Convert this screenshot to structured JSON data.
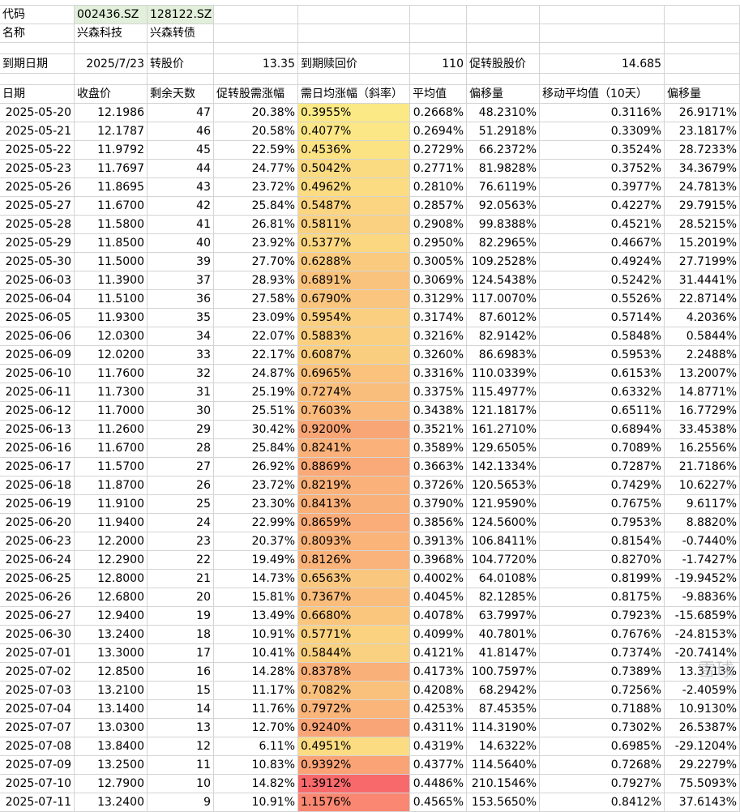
{
  "info": {
    "code_label": "代码",
    "code_stock": "002436.SZ",
    "code_bond": "128122.SZ",
    "name_label": "名称",
    "name_stock": "兴森科技",
    "name_bond": "兴森转债",
    "expiry_label": "到期日期",
    "expiry_value": "2025/7/23",
    "conv_label": "转股价",
    "conv_value": "13.35",
    "redeem_label": "到期赎回价",
    "redeem_value": "110",
    "promote_label": "促转股股价",
    "promote_value": "14.685"
  },
  "headers": [
    "日期",
    "收盘价",
    "剩余天数",
    "促转股需涨幅",
    "需日均涨幅（斜率）",
    "平均值",
    "偏移量",
    "移动平均值（10天）",
    "偏移量"
  ],
  "rows": [
    [
      "2025-05-20",
      "12.1986",
      "47",
      "20.38%",
      "0.3955%",
      "0.2668%",
      "48.2310%",
      "0.3116%",
      "26.9171%"
    ],
    [
      "2025-05-21",
      "12.1787",
      "46",
      "20.58%",
      "0.4077%",
      "0.2694%",
      "51.2918%",
      "0.3309%",
      "23.1817%"
    ],
    [
      "2025-05-22",
      "11.9792",
      "45",
      "22.59%",
      "0.4536%",
      "0.2729%",
      "66.2372%",
      "0.3524%",
      "28.7233%"
    ],
    [
      "2025-05-23",
      "11.7697",
      "44",
      "24.77%",
      "0.5042%",
      "0.2771%",
      "81.9828%",
      "0.3752%",
      "34.3679%"
    ],
    [
      "2025-05-26",
      "11.8695",
      "43",
      "23.72%",
      "0.4962%",
      "0.2810%",
      "76.6119%",
      "0.3977%",
      "24.7813%"
    ],
    [
      "2025-05-27",
      "11.6700",
      "42",
      "25.84%",
      "0.5487%",
      "0.2857%",
      "92.0563%",
      "0.4227%",
      "29.7915%"
    ],
    [
      "2025-05-28",
      "11.5800",
      "41",
      "26.81%",
      "0.5811%",
      "0.2908%",
      "99.8388%",
      "0.4521%",
      "28.5215%"
    ],
    [
      "2025-05-29",
      "11.8500",
      "40",
      "23.92%",
      "0.5377%",
      "0.2950%",
      "82.2965%",
      "0.4667%",
      "15.2019%"
    ],
    [
      "2025-05-30",
      "11.5000",
      "39",
      "27.70%",
      "0.6288%",
      "0.3005%",
      "109.2528%",
      "0.4924%",
      "27.7199%"
    ],
    [
      "2025-06-03",
      "11.3900",
      "37",
      "28.93%",
      "0.6891%",
      "0.3069%",
      "124.5438%",
      "0.5242%",
      "31.4441%"
    ],
    [
      "2025-06-04",
      "11.5100",
      "36",
      "27.58%",
      "0.6790%",
      "0.3129%",
      "117.0070%",
      "0.5526%",
      "22.8714%"
    ],
    [
      "2025-06-05",
      "11.9300",
      "35",
      "23.09%",
      "0.5954%",
      "0.3174%",
      "87.6012%",
      "0.5714%",
      "4.2036%"
    ],
    [
      "2025-06-06",
      "12.0300",
      "34",
      "22.07%",
      "0.5883%",
      "0.3216%",
      "82.9142%",
      "0.5848%",
      "0.5844%"
    ],
    [
      "2025-06-09",
      "12.0200",
      "33",
      "22.17%",
      "0.6087%",
      "0.3260%",
      "86.6983%",
      "0.5953%",
      "2.2488%"
    ],
    [
      "2025-06-10",
      "11.7600",
      "32",
      "24.87%",
      "0.6965%",
      "0.3316%",
      "110.0339%",
      "0.6153%",
      "13.2007%"
    ],
    [
      "2025-06-11",
      "11.7300",
      "31",
      "25.19%",
      "0.7274%",
      "0.3375%",
      "115.4977%",
      "0.6332%",
      "14.8771%"
    ],
    [
      "2025-06-12",
      "11.7000",
      "30",
      "25.51%",
      "0.7603%",
      "0.3438%",
      "121.1817%",
      "0.6511%",
      "16.7729%"
    ],
    [
      "2025-06-13",
      "11.2600",
      "29",
      "30.42%",
      "0.9200%",
      "0.3521%",
      "161.2710%",
      "0.6894%",
      "33.4538%"
    ],
    [
      "2025-06-16",
      "11.6700",
      "28",
      "25.84%",
      "0.8241%",
      "0.3589%",
      "129.6505%",
      "0.7089%",
      "16.2556%"
    ],
    [
      "2025-06-17",
      "11.5700",
      "27",
      "26.92%",
      "0.8869%",
      "0.3663%",
      "142.1334%",
      "0.7287%",
      "21.7186%"
    ],
    [
      "2025-06-18",
      "11.8700",
      "26",
      "23.72%",
      "0.8219%",
      "0.3726%",
      "120.5653%",
      "0.7429%",
      "10.6227%"
    ],
    [
      "2025-06-19",
      "11.9100",
      "25",
      "23.30%",
      "0.8413%",
      "0.3790%",
      "121.9590%",
      "0.7675%",
      "9.6117%"
    ],
    [
      "2025-06-20",
      "11.9400",
      "24",
      "22.99%",
      "0.8659%",
      "0.3856%",
      "124.5600%",
      "0.7953%",
      "8.8820%"
    ],
    [
      "2025-06-23",
      "12.2000",
      "23",
      "20.37%",
      "0.8093%",
      "0.3913%",
      "106.8411%",
      "0.8154%",
      "-0.7440%"
    ],
    [
      "2025-06-24",
      "12.2900",
      "22",
      "19.49%",
      "0.8126%",
      "0.3968%",
      "104.7720%",
      "0.8270%",
      "-1.7427%"
    ],
    [
      "2025-06-25",
      "12.8000",
      "21",
      "14.73%",
      "0.6563%",
      "0.4002%",
      "64.0108%",
      "0.8199%",
      "-19.9452%"
    ],
    [
      "2025-06-26",
      "12.6800",
      "20",
      "15.81%",
      "0.7367%",
      "0.4045%",
      "82.1285%",
      "0.8175%",
      "-9.8836%"
    ],
    [
      "2025-06-27",
      "12.9400",
      "19",
      "13.49%",
      "0.6680%",
      "0.4078%",
      "63.7997%",
      "0.7923%",
      "-15.6859%"
    ],
    [
      "2025-06-30",
      "13.2400",
      "18",
      "10.91%",
      "0.5771%",
      "0.4099%",
      "40.7801%",
      "0.7676%",
      "-24.8153%"
    ],
    [
      "2025-07-01",
      "13.3000",
      "17",
      "10.41%",
      "0.5844%",
      "0.4121%",
      "41.8147%",
      "0.7374%",
      "-20.7414%"
    ],
    [
      "2025-07-02",
      "12.8500",
      "16",
      "14.28%",
      "0.8378%",
      "0.4173%",
      "100.7597%",
      "0.7389%",
      "13.3713%"
    ],
    [
      "2025-07-03",
      "13.2100",
      "15",
      "11.17%",
      "0.7082%",
      "0.4208%",
      "68.2942%",
      "0.7256%",
      "-2.4059%"
    ],
    [
      "2025-07-04",
      "13.1400",
      "14",
      "11.76%",
      "0.7972%",
      "0.4253%",
      "87.4535%",
      "0.7188%",
      "10.9130%"
    ],
    [
      "2025-07-07",
      "13.0300",
      "13",
      "12.70%",
      "0.9240%",
      "0.4311%",
      "114.3190%",
      "0.7302%",
      "26.5387%"
    ],
    [
      "2025-07-08",
      "13.8400",
      "12",
      "6.11%",
      "0.4951%",
      "0.4319%",
      "14.6322%",
      "0.6985%",
      "-29.1204%"
    ],
    [
      "2025-07-09",
      "13.2500",
      "11",
      "10.83%",
      "0.9392%",
      "0.4377%",
      "114.5640%",
      "0.7268%",
      "29.2279%"
    ],
    [
      "2025-07-10",
      "12.7900",
      "10",
      "14.82%",
      "1.3912%",
      "0.4486%",
      "210.1546%",
      "0.7927%",
      "75.5093%"
    ],
    [
      "2025-07-11",
      "13.2400",
      "9",
      "10.91%",
      "1.1576%",
      "0.4565%",
      "153.5650%",
      "0.8412%",
      "37.6143%"
    ]
  ],
  "heat": {
    "min": 0.3955,
    "max": 1.3912,
    "low_color": "#fbe985",
    "high_color": "#f8696b"
  },
  "watermark": "雪球"
}
